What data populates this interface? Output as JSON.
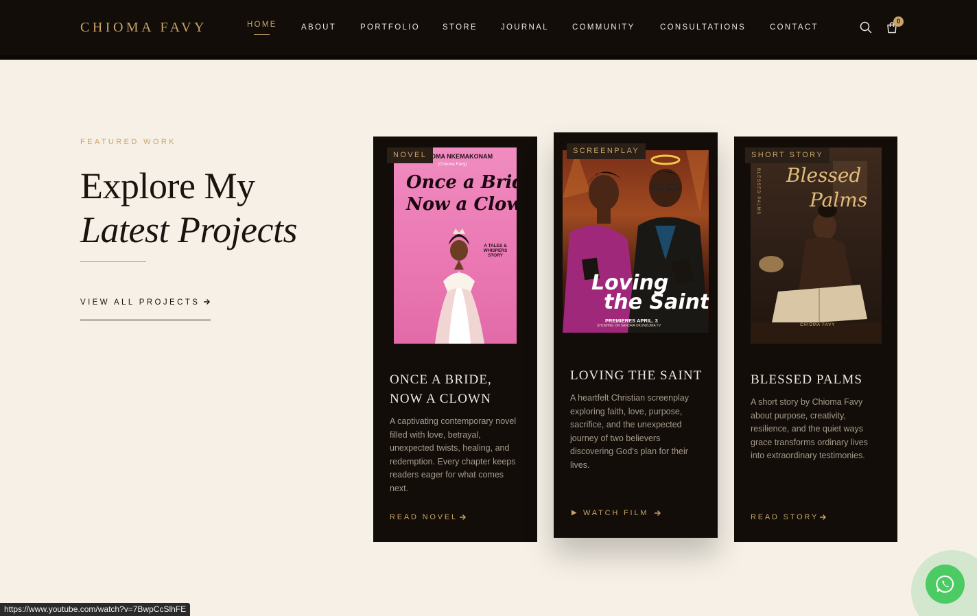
{
  "header": {
    "logo": "CHIOMA FAVY",
    "nav": [
      {
        "label": "HOME",
        "active": true
      },
      {
        "label": "ABOUT"
      },
      {
        "label": "PORTFOLIO"
      },
      {
        "label": "STORE"
      },
      {
        "label": "JOURNAL"
      },
      {
        "label": "COMMUNITY"
      },
      {
        "label": "CONSULTATIONS"
      },
      {
        "label": "CONTACT"
      }
    ],
    "cart_count": "0",
    "icons": {
      "search": "search-icon",
      "cart": "shopping-bag-icon"
    }
  },
  "intro": {
    "eyebrow": "FEATURED WORK",
    "headline_line1": "Explore My",
    "headline_line2": "Latest Projects",
    "view_all": "VIEW ALL PROJECTS"
  },
  "cards": [
    {
      "badge": "NOVEL",
      "title_line1": "ONCE A BRIDE,",
      "title_line2": "NOW A CLOWN",
      "description": "A captivating contemporary novel filled with love, betrayal, unexpected twists, healing, and redemption. Every chapter keeps readers eager for what comes next.",
      "cta": "READ NOVEL",
      "cover": {
        "author": "OMA NKEMAKONAM",
        "author_sub": "(Chioma Favy)",
        "title_line1": "Once a Bride,",
        "title_line2": "Now a Clown.",
        "tagline": "A TALES & WHISPERS STORY"
      }
    },
    {
      "badge": "SCREENPLAY",
      "title": "LOVING THE SAINT",
      "description": "A heartfelt Christian screenplay exploring faith, love, purpose, sacrifice, and the unexpected journey of two believers discovering God's plan for their lives.",
      "cta": "WATCH FILM",
      "cover": {
        "title_line1": "Loving",
        "title_line2": "the Saint",
        "premiere": "PREMIERES APRIL. 3",
        "showing": "SHOWING ON SANDRA OKUNZUWA TV"
      }
    },
    {
      "badge": "SHORT STORY",
      "title": "BLESSED PALMS",
      "description": "A short story by Chioma Favy about purpose, creativity, resilience, and the quiet ways grace transforms ordinary lives into extraordinary testimonies.",
      "cta": "READ STORY",
      "cover": {
        "title_line1": "Blessed",
        "title_line2": "Palms",
        "spine": "BLESSED PALMS",
        "byline": "CHIOMA FAVY"
      }
    }
  ],
  "status_url": "https://www.youtube.com/watch?v=7BwpCcSlhFE",
  "colors": {
    "accent": "#c9a468",
    "dark": "#120d09",
    "page": "#f6f0e6",
    "whatsapp": "#4cca64"
  }
}
